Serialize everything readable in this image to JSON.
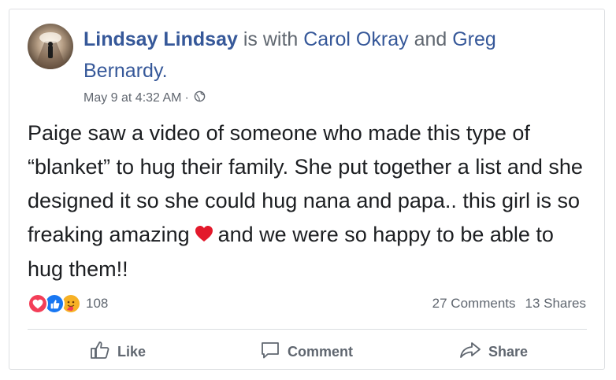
{
  "post": {
    "author": "Lindsay Lindsay",
    "with_text": " is with ",
    "tag1": "Carol Okray",
    "and_text": " and ",
    "tag2": "Greg Bernardy.",
    "timestamp": "May 9 at 4:32 AM",
    "separator": "·",
    "privacy_icon": "globe-icon",
    "text_part1": "Paige saw a video of someone who made this type of “blanket” to hug their family. She put together a list and she designed it so she could hug nana and papa.. this girl is so freaking amazing",
    "text_emoji": "red-heart-emoji",
    "text_part2": "and we were so happy to be able to hug them!!"
  },
  "reactions": {
    "icons": [
      "love-react-icon",
      "like-react-icon",
      "care-react-icon"
    ],
    "count": "108",
    "comments": "27 Comments",
    "shares": "13 Shares"
  },
  "actions": {
    "like": "Like",
    "comment": "Comment",
    "share": "Share"
  },
  "colors": {
    "link": "#365899",
    "secondary": "#606770",
    "love": "#f33e58",
    "like": "#1877f2",
    "care": "#f7b125"
  }
}
